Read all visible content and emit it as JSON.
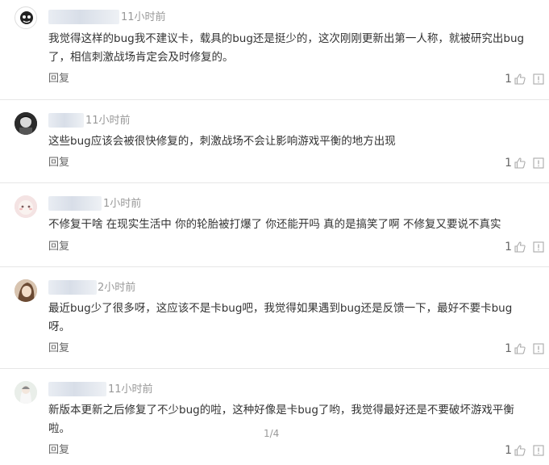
{
  "comments": [
    {
      "time": "11小时前",
      "lines": [
        "我觉得这样的bug我不建议卡，载具的bug还是挺少的，这次刚刚更新出第一人称，就被研究出bug",
        "了，相信刺激战场肯定会及时修复的。"
      ],
      "reply": "回复",
      "likes": "1"
    },
    {
      "time": "11小时前",
      "lines": [
        "这些bug应该会被很快修复的，刺激战场不会让影响游戏平衡的地方出现"
      ],
      "reply": "回复",
      "likes": "1"
    },
    {
      "time": "1小时前",
      "lines": [
        "不修复干啥 在现实生活中 你的轮胎被打爆了 你还能开吗 真的是搞笑了啊 不修复又要说不真实"
      ],
      "reply": "回复",
      "likes": "1"
    },
    {
      "time": "2小时前",
      "lines": [
        "最近bug少了很多呀，这应该不是卡bug吧，我觉得如果遇到bug还是反馈一下，最好不要卡bug",
        "呀。"
      ],
      "reply": "回复",
      "likes": "1"
    },
    {
      "time": "11小时前",
      "lines": [
        "新版本更新之后修复了不少bug的啦，这种好像是卡bug了哟，我觉得最好还是不要破坏游戏平衡",
        "啦。"
      ],
      "reply": "回复",
      "likes": "1"
    }
  ],
  "pager": "1/4",
  "icons": {
    "like": "thumbs-up-icon",
    "report": "report-icon"
  },
  "colors": {
    "text": "#333333",
    "meta": "#999999",
    "divider": "#e6e6e6"
  }
}
